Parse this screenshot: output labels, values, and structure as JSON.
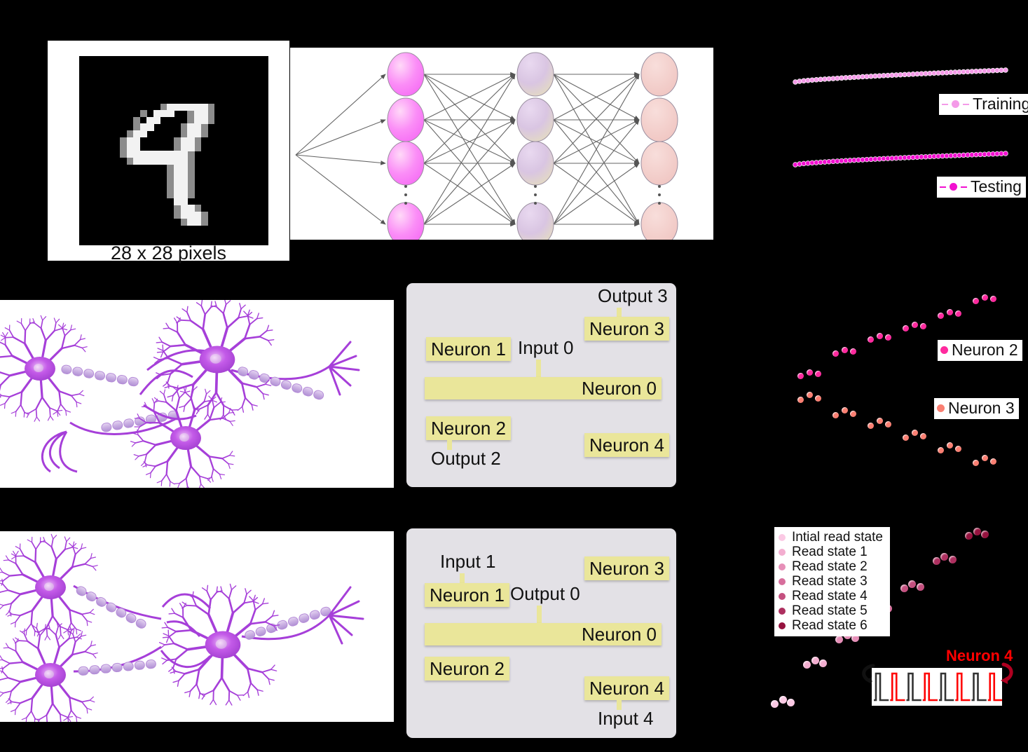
{
  "figure": {
    "background": "#000000",
    "accent_magenta": "#ff26c8",
    "accent_salmon": "#fa8072",
    "accent_red": "#ff0000"
  },
  "mnist": {
    "caption": "28 x 28 pixels",
    "digit": "4",
    "grid": 28
  },
  "neural_net": {
    "layers": [
      {
        "name": "input-layer",
        "visible_nodes": 4,
        "color": "#f77ef7"
      },
      {
        "name": "hidden-layer",
        "visible_nodes": 4,
        "color": "#d9c6e0"
      },
      {
        "name": "output-layer",
        "visible_nodes": 4,
        "color": "#f2c9c6"
      }
    ],
    "ellipsis": "⋮"
  },
  "chart_training": {
    "type": "line",
    "title": "",
    "xlabel": "",
    "ylabel": "",
    "grid": false,
    "legend_position": "right",
    "series": [
      {
        "name": "Training",
        "color": "#f49ae8",
        "marker": "circle",
        "linestyle": "dashed",
        "x": [
          0,
          2,
          4,
          6,
          8,
          10,
          12,
          14,
          16,
          18,
          20,
          22,
          24,
          26,
          28,
          30,
          32,
          34,
          36,
          38,
          40,
          42,
          44,
          46,
          48,
          50,
          52,
          54,
          56,
          58,
          60,
          62,
          64,
          66,
          68,
          70,
          72,
          74,
          76,
          78,
          80,
          82,
          84,
          86,
          88,
          90,
          92,
          94,
          96,
          98,
          100
        ],
        "y": [
          0.92,
          0.923,
          0.926,
          0.929,
          0.931,
          0.934,
          0.936,
          0.938,
          0.94,
          0.942,
          0.944,
          0.946,
          0.947,
          0.949,
          0.95,
          0.952,
          0.953,
          0.955,
          0.956,
          0.957,
          0.958,
          0.959,
          0.961,
          0.962,
          0.963,
          0.964,
          0.965,
          0.966,
          0.967,
          0.968,
          0.969,
          0.97,
          0.971,
          0.972,
          0.973,
          0.974,
          0.975,
          0.976,
          0.977,
          0.978,
          0.979,
          0.979,
          0.98,
          0.98,
          0.981,
          0.981,
          0.982,
          0.982,
          0.982,
          0.983,
          0.983
        ]
      },
      {
        "name": "Testing",
        "color": "#f210d0",
        "marker": "circle",
        "linestyle": "dashed",
        "x": [
          0,
          2,
          4,
          6,
          8,
          10,
          12,
          14,
          16,
          18,
          20,
          22,
          24,
          26,
          28,
          30,
          32,
          34,
          36,
          38,
          40,
          42,
          44,
          46,
          48,
          50,
          52,
          54,
          56,
          58,
          60,
          62,
          64,
          66,
          68,
          70,
          72,
          74,
          76,
          78,
          80,
          82,
          84,
          86,
          88,
          90,
          92,
          94,
          96,
          98,
          100
        ],
        "y": [
          0.8,
          0.803,
          0.806,
          0.809,
          0.812,
          0.815,
          0.818,
          0.82,
          0.823,
          0.825,
          0.828,
          0.83,
          0.832,
          0.834,
          0.836,
          0.838,
          0.84,
          0.842,
          0.844,
          0.846,
          0.848,
          0.849,
          0.851,
          0.852,
          0.854,
          0.855,
          0.857,
          0.858,
          0.859,
          0.861,
          0.862,
          0.863,
          0.864,
          0.865,
          0.866,
          0.867,
          0.868,
          0.869,
          0.87,
          0.871,
          0.872,
          0.873,
          0.873,
          0.874,
          0.875,
          0.875,
          0.876,
          0.876,
          0.877,
          0.877,
          0.878
        ]
      }
    ],
    "legend": [
      {
        "label": "Training",
        "color": "#f49ae8"
      },
      {
        "label": "Testing",
        "color": "#f210d0"
      }
    ]
  },
  "chart_neurons": {
    "type": "scatter",
    "title": "",
    "xlabel": "",
    "ylabel": "",
    "grid": false,
    "legend_position": "right",
    "series": [
      {
        "name": "Neuron 2",
        "color": "#ff2a9e",
        "trend": "ascending-staircase",
        "points": [
          {
            "x": 1,
            "y": 1
          },
          {
            "x": 2,
            "y": 1
          },
          {
            "x": 3,
            "y": 1
          },
          {
            "x": 5,
            "y": 2
          },
          {
            "x": 6,
            "y": 2
          },
          {
            "x": 7,
            "y": 2
          },
          {
            "x": 9,
            "y": 3
          },
          {
            "x": 10,
            "y": 3
          },
          {
            "x": 11,
            "y": 3
          },
          {
            "x": 13,
            "y": 4
          },
          {
            "x": 14,
            "y": 4
          },
          {
            "x": 15,
            "y": 4
          },
          {
            "x": 17,
            "y": 5
          },
          {
            "x": 18,
            "y": 5
          },
          {
            "x": 19,
            "y": 5
          },
          {
            "x": 21,
            "y": 6
          },
          {
            "x": 22,
            "y": 6
          },
          {
            "x": 23,
            "y": 6
          }
        ]
      },
      {
        "name": "Neuron 3",
        "color": "#fa7f72",
        "trend": "descending-staircase",
        "points": [
          {
            "x": 1,
            "y": 6
          },
          {
            "x": 2,
            "y": 6
          },
          {
            "x": 3,
            "y": 6
          },
          {
            "x": 5,
            "y": 5
          },
          {
            "x": 6,
            "y": 5
          },
          {
            "x": 7,
            "y": 5
          },
          {
            "x": 9,
            "y": 4
          },
          {
            "x": 10,
            "y": 4
          },
          {
            "x": 11,
            "y": 4
          },
          {
            "x": 13,
            "y": 3
          },
          {
            "x": 14,
            "y": 3
          },
          {
            "x": 15,
            "y": 3
          },
          {
            "x": 17,
            "y": 2
          },
          {
            "x": 18,
            "y": 2
          },
          {
            "x": 19,
            "y": 2
          },
          {
            "x": 21,
            "y": 1
          },
          {
            "x": 22,
            "y": 1
          },
          {
            "x": 23,
            "y": 1
          }
        ]
      }
    ],
    "legend": [
      {
        "label": "Neuron 2",
        "color": "#ff2a9e"
      },
      {
        "label": "Neuron 3",
        "color": "#fa7f72"
      }
    ]
  },
  "chart_readstates": {
    "type": "scatter",
    "title": "",
    "xlabel": "",
    "ylabel": "",
    "grid": false,
    "legend_position": "top-left",
    "legend": [
      {
        "label": "Intial read state",
        "color": "#fbc9e4"
      },
      {
        "label": "Read state 1",
        "color": "#f3aed0"
      },
      {
        "label": "Read state 2",
        "color": "#e68fb8"
      },
      {
        "label": "Read state 3",
        "color": "#d76e9c"
      },
      {
        "label": "Read state 4",
        "color": "#c4507f"
      },
      {
        "label": "Read state 5",
        "color": "#ad2f5f"
      },
      {
        "label": "Read state 6",
        "color": "#96133f"
      }
    ],
    "series": [
      {
        "name": "Intial read state",
        "color": "#fbc9e4",
        "points": [
          {
            "x": 1,
            "y": 1
          },
          {
            "x": 2,
            "y": 1
          },
          {
            "x": 3,
            "y": 1
          }
        ]
      },
      {
        "name": "Read state 1",
        "color": "#f3aed0",
        "points": [
          {
            "x": 5,
            "y": 2
          },
          {
            "x": 6,
            "y": 2
          },
          {
            "x": 7,
            "y": 2
          }
        ]
      },
      {
        "name": "Read state 2",
        "color": "#e68fb8",
        "points": [
          {
            "x": 9,
            "y": 3
          },
          {
            "x": 10,
            "y": 3
          },
          {
            "x": 11,
            "y": 3
          }
        ]
      },
      {
        "name": "Read state 3",
        "color": "#d76e9c",
        "points": [
          {
            "x": 13,
            "y": 4
          },
          {
            "x": 14,
            "y": 4
          },
          {
            "x": 15,
            "y": 4
          }
        ]
      },
      {
        "name": "Read state 4",
        "color": "#c4507f",
        "points": [
          {
            "x": 17,
            "y": 5
          },
          {
            "x": 18,
            "y": 5
          },
          {
            "x": 19,
            "y": 5
          }
        ]
      },
      {
        "name": "Read state 5",
        "color": "#ad2f5f",
        "points": [
          {
            "x": 21,
            "y": 6
          },
          {
            "x": 22,
            "y": 6
          },
          {
            "x": 23,
            "y": 6
          }
        ]
      },
      {
        "name": "Read state 6",
        "color": "#96133f",
        "points": [
          {
            "x": 25,
            "y": 7
          },
          {
            "x": 26,
            "y": 7
          },
          {
            "x": 27,
            "y": 7
          }
        ]
      }
    ],
    "inset": {
      "label": "Neuron 4",
      "label_color": "#ff0000",
      "trace_colors": [
        "#333333",
        "#ff0000"
      ],
      "pulses": 8
    }
  },
  "schematic_top": {
    "labels": [
      {
        "id": "output-3",
        "text": "Output 3",
        "style": "plain"
      },
      {
        "id": "neuron-3",
        "text": "Neuron 3",
        "style": "chip"
      },
      {
        "id": "neuron-1",
        "text": "Neuron 1",
        "style": "chip"
      },
      {
        "id": "input-0",
        "text": "Input 0",
        "style": "plain"
      },
      {
        "id": "neuron-0",
        "text": "Neuron 0",
        "style": "bar"
      },
      {
        "id": "neuron-2",
        "text": "Neuron 2",
        "style": "chip"
      },
      {
        "id": "output-2",
        "text": "Output 2",
        "style": "plain"
      },
      {
        "id": "neuron-4",
        "text": "Neuron 4",
        "style": "chip"
      }
    ]
  },
  "schematic_bottom": {
    "labels": [
      {
        "id": "input-1",
        "text": "Input 1",
        "style": "plain"
      },
      {
        "id": "neuron-3",
        "text": "Neuron 3",
        "style": "chip"
      },
      {
        "id": "neuron-1",
        "text": "Neuron 1",
        "style": "chip"
      },
      {
        "id": "output-0",
        "text": "Output 0",
        "style": "plain"
      },
      {
        "id": "neuron-0",
        "text": "Neuron 0",
        "style": "bar"
      },
      {
        "id": "neuron-2",
        "text": "Neuron 2",
        "style": "chip"
      },
      {
        "id": "neuron-4",
        "text": "Neuron 4",
        "style": "chip"
      },
      {
        "id": "input-4",
        "text": "Input 4",
        "style": "plain"
      }
    ]
  },
  "bio_illustrations": [
    {
      "id": "neuron-network-top",
      "cells": 3,
      "color": "#a63fd9"
    },
    {
      "id": "neuron-network-bottom",
      "cells": 3,
      "color": "#a63fd9"
    }
  ]
}
